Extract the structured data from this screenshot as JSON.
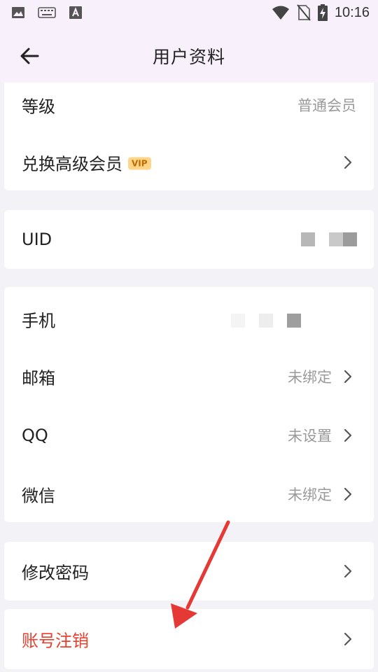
{
  "status_bar": {
    "time": "10:16",
    "left_icons": [
      "image-icon",
      "keyboard-icon",
      "font-icon"
    ],
    "right_icons": [
      "wifi-icon",
      "no-sim-icon",
      "battery-charging-icon"
    ]
  },
  "header": {
    "title": "用户资料",
    "back_icon": "arrow-left-icon"
  },
  "sections": {
    "membership": {
      "level_label": "等级",
      "level_value": "普通会员",
      "upgrade_label": "兑换高级会员",
      "upgrade_badge": "VIP"
    },
    "uid": {
      "label": "UID"
    },
    "bindings": {
      "phone_label": "手机",
      "email_label": "邮箱",
      "email_value": "未绑定",
      "qq_label": "QQ",
      "qq_value": "未设置",
      "wechat_label": "微信",
      "wechat_value": "未绑定"
    },
    "security": {
      "change_password_label": "修改密码"
    },
    "danger": {
      "delete_account_label": "账号注销"
    }
  },
  "colors": {
    "header_bg": "#f8f0fb",
    "page_bg": "#f3f2f6",
    "danger": "#e8402f",
    "vip_badge": "#ffd58a",
    "annotation_arrow": "#e53935"
  }
}
